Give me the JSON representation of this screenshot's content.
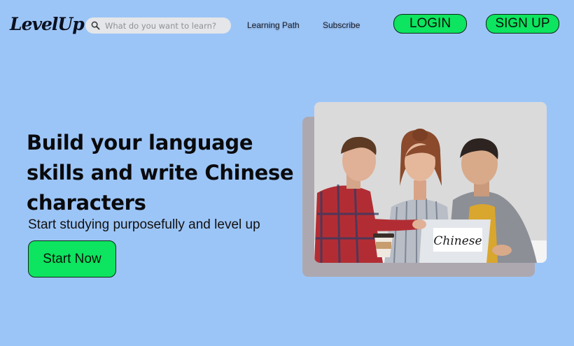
{
  "nav": {
    "logo": "LevelUp",
    "search_placeholder": "What do you want to learn?",
    "links": [
      "Learning Path",
      "Subscribe"
    ],
    "login_label": "LOGIN",
    "signup_label": "SIGN UP"
  },
  "hero": {
    "title": "Build your language skills and write Chinese characters",
    "subtitle": "Start studying purposefully and level up",
    "cta_label": "Start Now"
  },
  "photo": {
    "screen_text": "Chinese"
  },
  "colors": {
    "background": "#9cc5f7",
    "accent_green": "#0de45f",
    "photo_shadow": "#ada8b0"
  }
}
